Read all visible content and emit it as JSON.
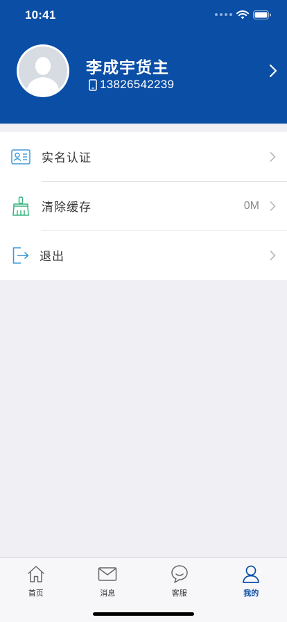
{
  "status_bar": {
    "time": "10:41"
  },
  "profile": {
    "name": "李成宇货主",
    "phone": "13826542239"
  },
  "menu": {
    "items": [
      {
        "label": "实名认证",
        "icon": "id-card-icon",
        "value": ""
      },
      {
        "label": "清除缓存",
        "icon": "broom-icon",
        "value": "0M"
      },
      {
        "label": "退出",
        "icon": "logout-icon",
        "value": ""
      }
    ]
  },
  "tabbar": {
    "active": "我的",
    "tabs": [
      {
        "label": "首页",
        "icon": "home-icon"
      },
      {
        "label": "消息",
        "icon": "mail-icon"
      },
      {
        "label": "客服",
        "icon": "chat-icon"
      },
      {
        "label": "我的",
        "icon": "person-icon"
      }
    ]
  },
  "colors": {
    "header": "#0a4ea6",
    "accent_blue": "#3d9ad8",
    "accent_green": "#36b37e",
    "background": "#efeff4"
  }
}
